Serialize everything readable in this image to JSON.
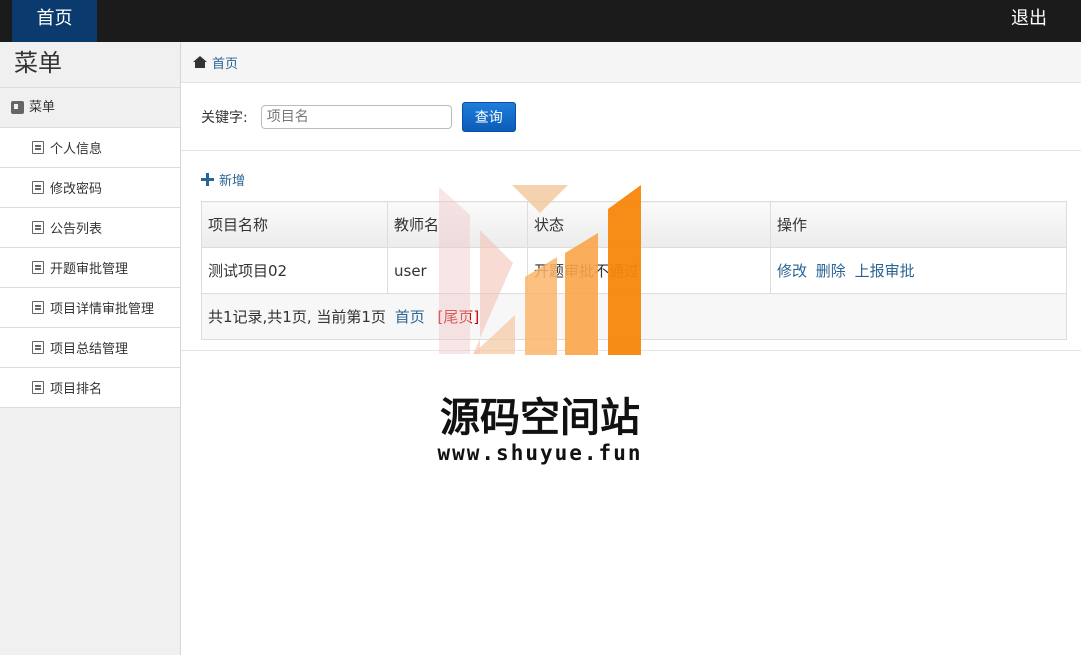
{
  "topbar": {
    "home_label": "首页",
    "logout_label": "退出"
  },
  "sidebar": {
    "title": "菜单",
    "group_label": "菜单",
    "items": [
      {
        "label": "个人信息"
      },
      {
        "label": "修改密码"
      },
      {
        "label": "公告列表"
      },
      {
        "label": "开题审批管理"
      },
      {
        "label": "项目详情审批管理"
      },
      {
        "label": "项目总结管理"
      },
      {
        "label": "项目排名"
      }
    ]
  },
  "breadcrumb": {
    "home": "首页"
  },
  "search": {
    "label": "关键字:",
    "placeholder": "项目名",
    "button": "查询"
  },
  "actions": {
    "add_label": "新增"
  },
  "table": {
    "headers": [
      "项目名称",
      "教师名",
      "状态",
      "操作"
    ],
    "rows": [
      {
        "name": "测试项目02",
        "teacher": "user",
        "status": "开题审批不通过",
        "ops": [
          "修改",
          "删除",
          "上报审批"
        ]
      }
    ],
    "pager": {
      "summary": "共1记录,共1页, 当前第1页",
      "first": "首页",
      "last": "[尾页]"
    }
  },
  "watermark": {
    "title": "源码空间站",
    "url": "www.shuyue.fun"
  },
  "colors": {
    "topbar": "#1b1b1b",
    "home_tab": "#0b3a6e",
    "link": "#2a6496",
    "button": "#0c5cb8"
  }
}
